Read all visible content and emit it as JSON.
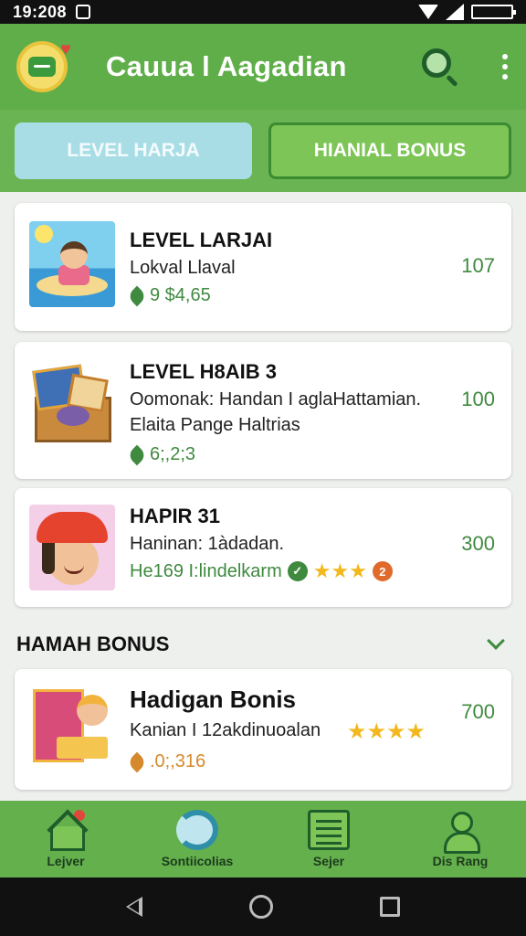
{
  "status_bar": {
    "time": "19:208"
  },
  "app_bar": {
    "title": "Cauua l Aagadian"
  },
  "tabs": [
    {
      "label": "LEVEL HARJA"
    },
    {
      "label": "HIANIAL BONUS"
    }
  ],
  "cards": [
    {
      "title": "LEVEL LARJAI",
      "lines": [
        "Lokval Llaval"
      ],
      "meta": "9 $4,65",
      "score": "107"
    },
    {
      "title": "LEVEL H8AIB 3",
      "lines": [
        "Oomonak: Handan I aglaHattamian.",
        "Elaita Pange Haltrias"
      ],
      "meta": "6;,2;3",
      "score": "100"
    },
    {
      "title": "HAPIR 31",
      "lines": [
        "Haninan: 1àdadan."
      ],
      "meta": "He169 I:lindelkarm",
      "score": "300"
    }
  ],
  "section": {
    "title": "HAMAH BONUS"
  },
  "bonus_card": {
    "title": "Hadigan Bonis",
    "line": "Kanian I 12akdinuoalan",
    "meta": ".0;,316",
    "score": "700"
  },
  "bottom_nav": [
    {
      "label": "Lejver"
    },
    {
      "label": "Sontiicolias"
    },
    {
      "label": "Sejer"
    },
    {
      "label": "Dis Rang"
    }
  ],
  "colors": {
    "primary_green": "#5fae4a",
    "accent_star": "#f2b81d",
    "score_green": "#3f8a3f"
  }
}
